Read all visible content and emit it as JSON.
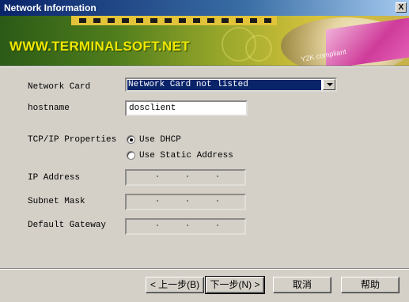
{
  "window": {
    "title": "Network Information",
    "close_label": "X"
  },
  "banner": {
    "brand": "WWW.TERMINALSOFT.NET",
    "badge": "Y2K compliant"
  },
  "form": {
    "network_card": {
      "label": "Network Card",
      "value": "Network Card not listed"
    },
    "hostname": {
      "label": "hostname",
      "value": "dosclient"
    },
    "tcpip": {
      "label": "TCP/IP Properties",
      "options": [
        {
          "label": "Use DHCP",
          "selected": true
        },
        {
          "label": "Use Static Address",
          "selected": false
        }
      ]
    },
    "ip_address": {
      "label": "IP Address"
    },
    "subnet_mask": {
      "label": "Subnet Mask"
    },
    "default_gateway": {
      "label": "Default Gateway"
    }
  },
  "buttons": {
    "back": "< 上一步(B)",
    "next": "下一步(N) >",
    "cancel": "取消",
    "help": "帮助"
  }
}
